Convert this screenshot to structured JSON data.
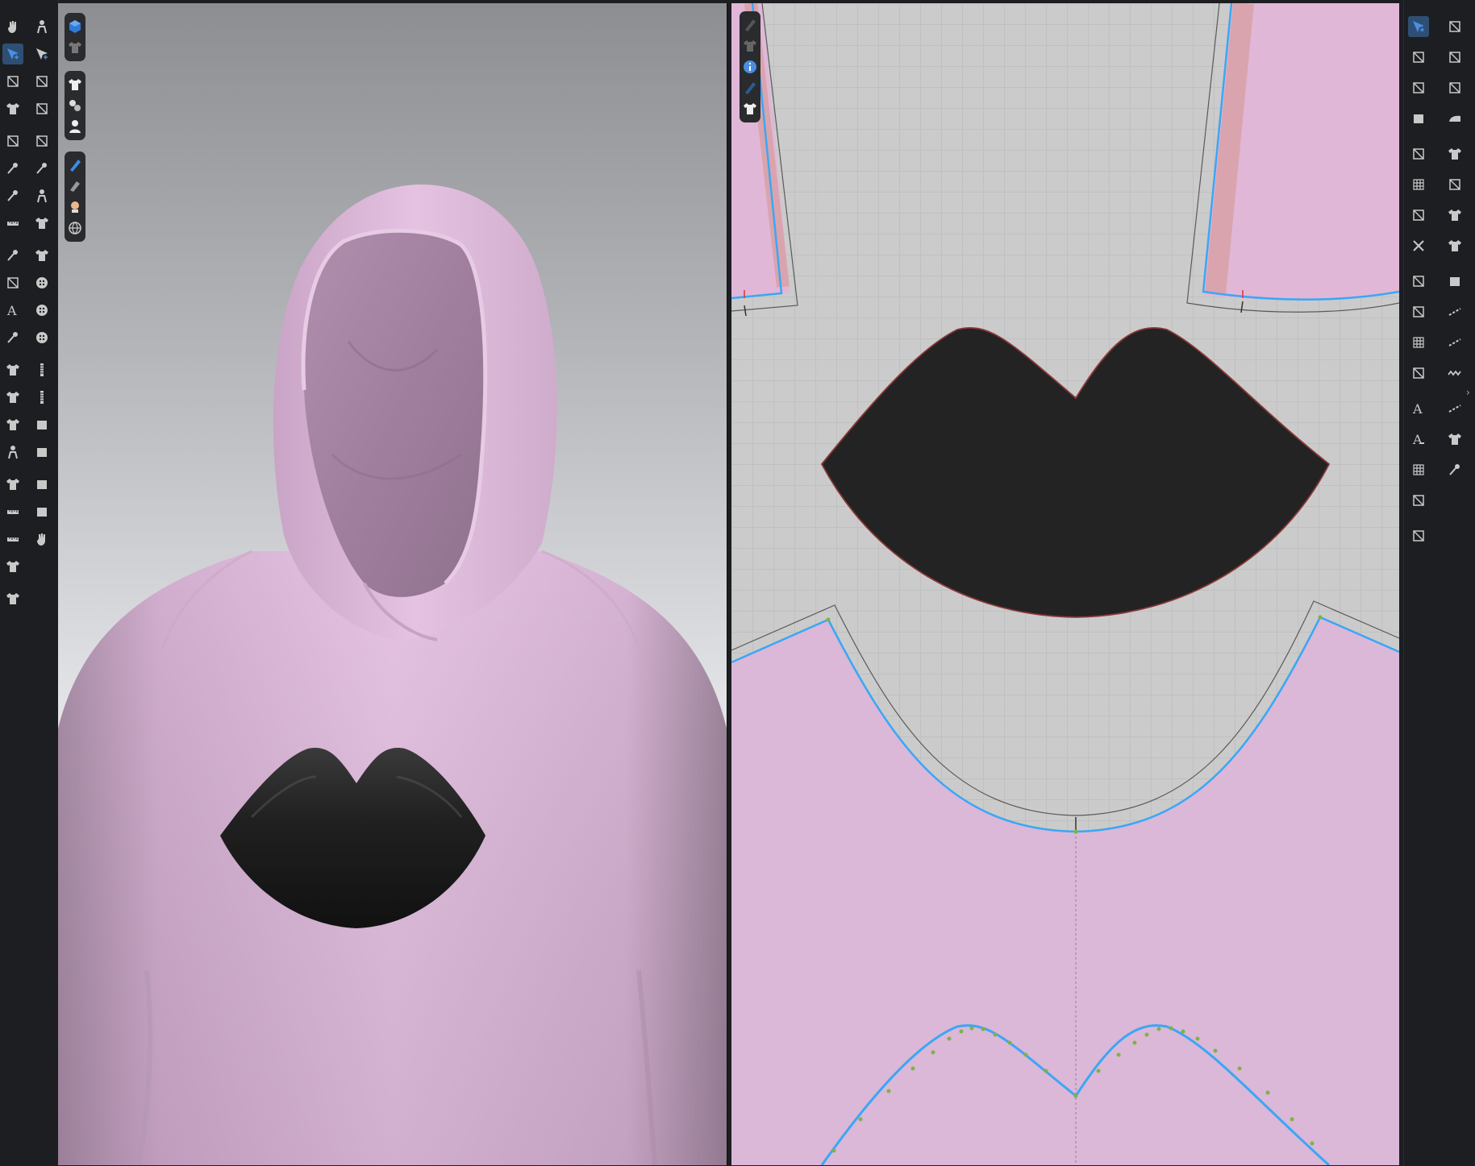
{
  "app": {
    "accent_color": "#2e6fb5",
    "garment_color": "#e3bde0",
    "pattern_fill_color": "#dbb7d8",
    "print_color": "#232323",
    "seam_line_color": "#3aa7f5"
  },
  "left_toolbar": {
    "column1": [
      "hand-tool-icon",
      "transform-select-icon",
      "edit-pattern-icon",
      "garment-select-icon",
      "fold-arrange-icon",
      "tack-icon",
      "pin-icon",
      "avatar-measure-icon",
      "needle-icon",
      "strengthen-icon",
      "texture-edit-icon",
      "fabric-stack-icon",
      "garment-show-icon",
      "garment-hide-icon",
      "shirt-lift-icon",
      "avatar-pose-icon",
      "fitting-suit-icon",
      "tape-icon",
      "measure-ruler-icon",
      "shirt-front-icon",
      "shirt-back-icon"
    ],
    "column2": [
      "animation-pose-icon",
      "select-move-icon",
      "point-edit-icon",
      "curve-point-icon",
      "arrange-point-icon",
      "pin-box-icon",
      "reset-pose-icon",
      "check-shirt-icon",
      "pattern-shirt-icon",
      "button-icon",
      "snap-button-icon",
      "buttonhole-icon",
      "zipper-icon",
      "zipper-slider-icon",
      "solid-box-icon",
      "half-box-icon",
      "top-box-icon",
      "bottom-box-icon",
      "finger-pin-icon"
    ]
  },
  "viewport_3d_toolbar": {
    "group1": [
      "cube-view-icon",
      "shirt-gray-icon"
    ],
    "group2": [
      "shirt-white-icon",
      "shirt-sync-icon",
      "avatar-icon"
    ],
    "group3": [
      "pen-blue-icon",
      "eraser-icon",
      "skin-icon",
      "globe-icon"
    ]
  },
  "viewport_2d_toolbar": {
    "buttons": [
      "pen-dim-icon",
      "shirt-dim-icon",
      "info-icon",
      "pen-blue-dim-icon",
      "shirt-light-icon"
    ]
  },
  "right_toolbar": {
    "column1": [
      "select-pattern-icon",
      "edit-segment-icon",
      "polygon-icon",
      "rectangle-icon",
      "internal-polygon-icon",
      "grid-pattern-icon",
      "piece-copy-icon",
      "scissors-cross-icon",
      "fold-corner-icon",
      "notch-icon",
      "gradient-grid-icon",
      "trim-icon",
      "text-icon",
      "text-sub-icon",
      "graph-bars-icon",
      "sew-segment-icon",
      "sew-piece-icon"
    ],
    "column2": [
      "pattern-edit-icon",
      "pattern-trace-icon",
      "pattern-copy-icon",
      "iron-icon",
      "shirt-dark-icon",
      "spray-icon",
      "mesh-shirt-icon",
      "check-mesh-icon",
      "white-box-icon",
      "dash-line-icon",
      "dashed-strip-icon",
      "zigzag-icon",
      "wave-line-icon",
      "camera-shirt-icon",
      "stack-box-icon"
    ]
  }
}
